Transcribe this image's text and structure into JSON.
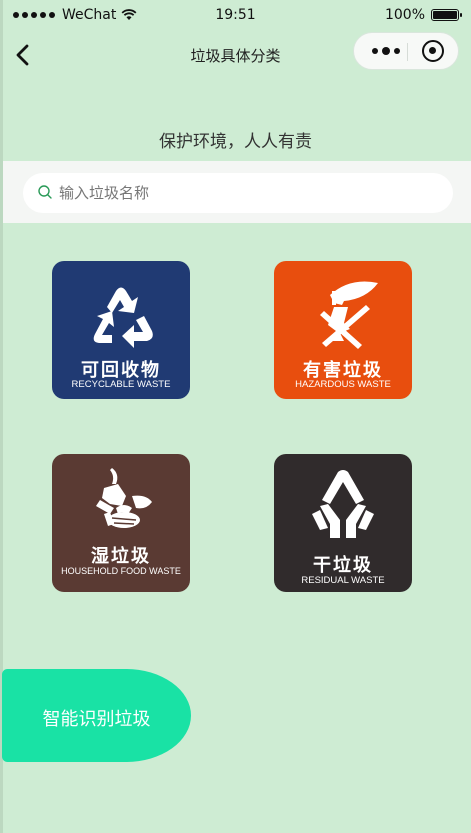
{
  "status_bar": {
    "carrier": "WeChat",
    "time": "19:51",
    "battery": "100%",
    "battery_level": 1.0
  },
  "nav": {
    "title": "垃圾具体分类"
  },
  "slogan": "保护环境，人人有责",
  "search": {
    "placeholder": "输入垃圾名称",
    "value": ""
  },
  "categories": [
    {
      "name_cn": "可回收物",
      "name_en": "RECYCLABLE WASTE",
      "color": "#203a73",
      "icon": "recycle-icon"
    },
    {
      "name_cn": "有害垃圾",
      "name_en": "HAZARDOUS WASTE",
      "color": "#e84e0e",
      "icon": "hazardous-icon"
    },
    {
      "name_cn": "湿垃圾",
      "name_en": "HOUSEHOLD FOOD WASTE",
      "color": "#5a3a33",
      "icon": "food-waste-icon"
    },
    {
      "name_cn": "干垃圾",
      "name_en": "RESIDUAL WASTE",
      "color": "#302b2c",
      "icon": "residual-icon"
    }
  ],
  "fab": {
    "label": "智能识别垃圾",
    "color": "#19e2a5"
  },
  "colors": {
    "background": "#ceecd3",
    "search_band": "#f4f6f4"
  }
}
